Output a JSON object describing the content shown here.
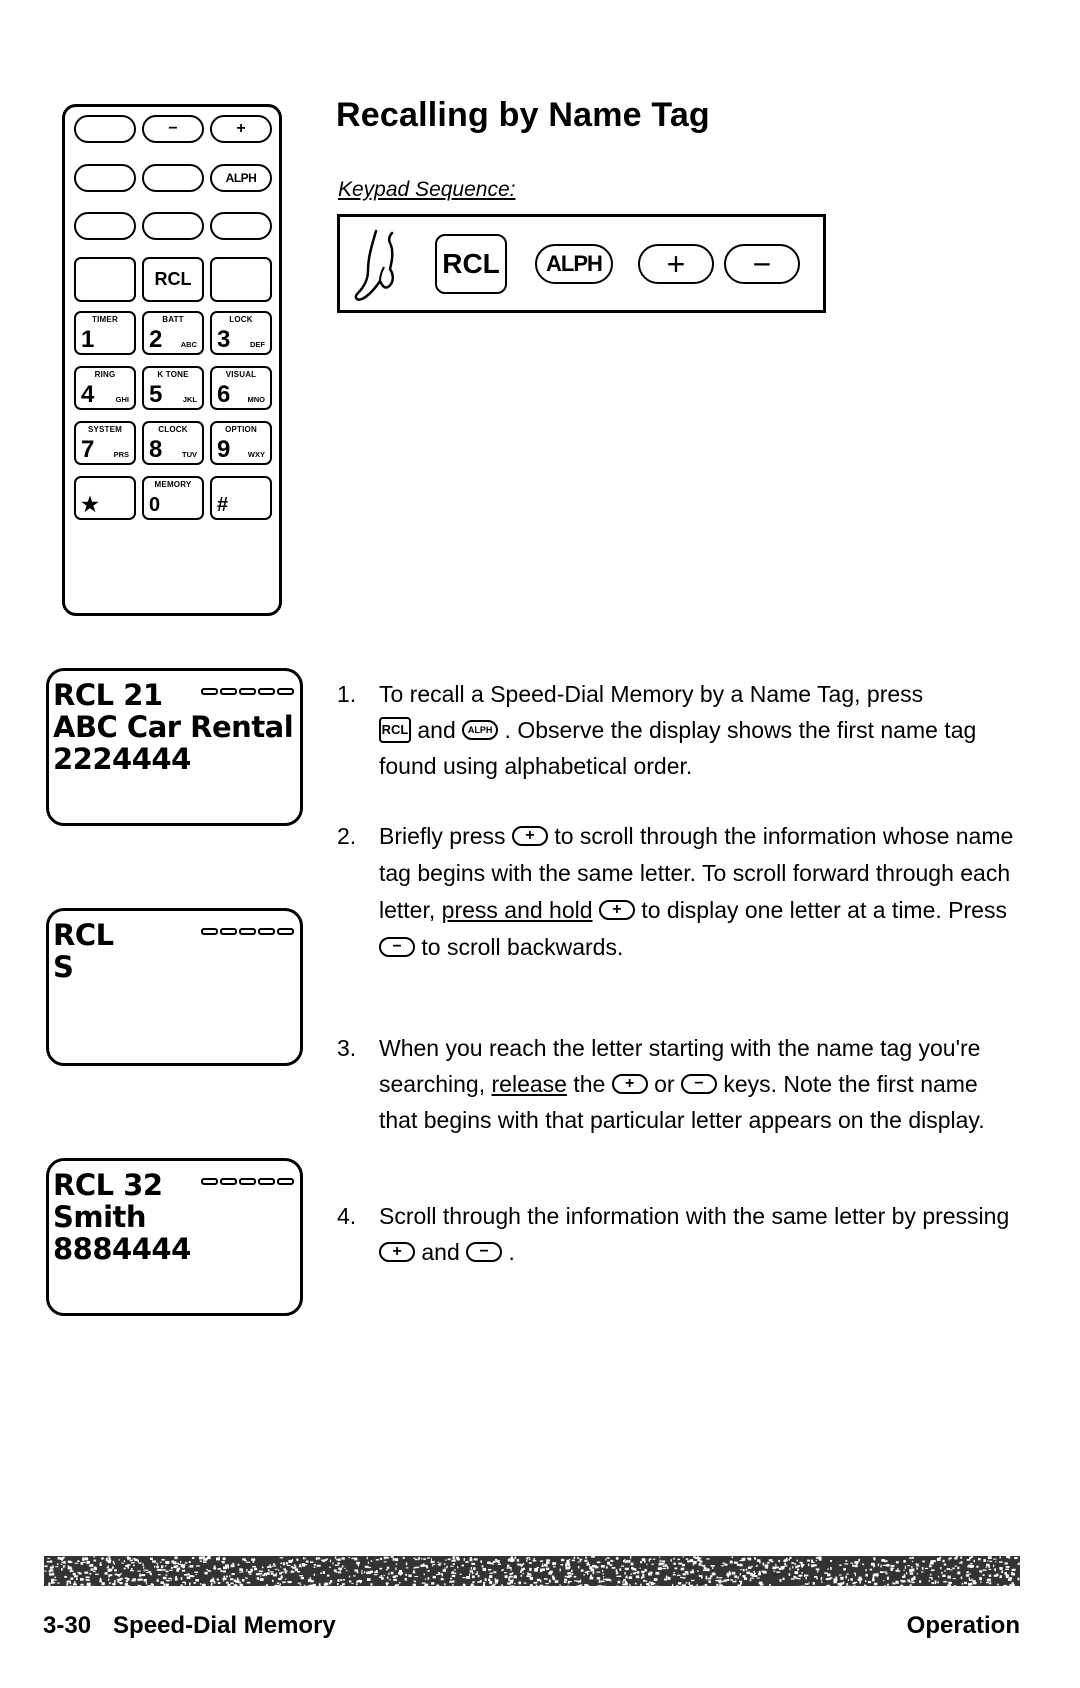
{
  "title": "Recalling by Name Tag",
  "keypad_sequence": {
    "label": "Keypad Sequence:",
    "icon": "finger-press-icon",
    "keys": [
      "RCL",
      "ALPH",
      "+",
      "−"
    ]
  },
  "phone": {
    "top_keys": [
      [
        "",
        "−",
        "+"
      ],
      [
        "",
        "",
        "ALPH"
      ],
      [
        "",
        "",
        ""
      ],
      [
        "",
        "RCL",
        ""
      ]
    ],
    "number_keys": [
      {
        "fn": "TIMER",
        "digit": "1",
        "letters": ""
      },
      {
        "fn": "BATT",
        "digit": "2",
        "letters": "ABC"
      },
      {
        "fn": "LOCK",
        "digit": "3",
        "letters": "DEF"
      },
      {
        "fn": "RING",
        "digit": "4",
        "letters": "GHI"
      },
      {
        "fn": "K TONE",
        "digit": "5",
        "letters": "JKL"
      },
      {
        "fn": "VISUAL",
        "digit": "6",
        "letters": "MNO"
      },
      {
        "fn": "SYSTEM",
        "digit": "7",
        "letters": "PRS"
      },
      {
        "fn": "CLOCK",
        "digit": "8",
        "letters": "TUV"
      },
      {
        "fn": "OPTION",
        "digit": "9",
        "letters": "WXY"
      },
      {
        "fn": "",
        "digit": "★",
        "letters": ""
      },
      {
        "fn": "MEMORY",
        "digit": "0",
        "letters": ""
      },
      {
        "fn": "",
        "digit": "#",
        "letters": ""
      }
    ]
  },
  "displays": [
    {
      "lines": [
        "RCL 21",
        "ABC Car Rental",
        "2224444"
      ],
      "indicator": "battery-signal-icon"
    },
    {
      "lines": [
        "RCL",
        "S",
        ""
      ],
      "indicator": "battery-signal-icon"
    },
    {
      "lines": [
        "RCL 32",
        "Smith",
        "8884444"
      ],
      "indicator": "battery-signal-icon"
    }
  ],
  "steps": [
    {
      "num": "1.",
      "parts": {
        "a": "To recall a Speed-Dial Memory by a Name Tag, press",
        "key1": "RCL",
        "b": " and ",
        "key2": "ALPH",
        "c": " .  Observe the display shows the first name tag found using alphabetical order."
      }
    },
    {
      "num": "2.",
      "parts": {
        "a": "Briefly press ",
        "key1": "+",
        "b": " to scroll through the information whose name tag begins with the same letter.  To scroll forward through each letter, ",
        "u": "press and hold",
        "c": " ",
        "key2": "+",
        "d": " to display one letter at a time.  Press ",
        "key3": "−",
        "e": " to scroll backwards."
      }
    },
    {
      "num": "3.",
      "parts": {
        "a": "When you reach the letter starting with the name tag you're searching, ",
        "u": "release",
        "b": " the ",
        "key1": "+",
        "c": " or ",
        "key2": "−",
        "d": " keys.  Note the first name that begins with that particular letter appears on the display."
      }
    },
    {
      "num": "4.",
      "parts": {
        "a": "Scroll through the information with the same letter by pressing ",
        "key1": "+",
        "b": " and ",
        "key2": "−",
        "c": " ."
      }
    }
  ],
  "footer": {
    "page": "3-30",
    "section": "Speed-Dial Memory",
    "chapter": "Operation"
  }
}
